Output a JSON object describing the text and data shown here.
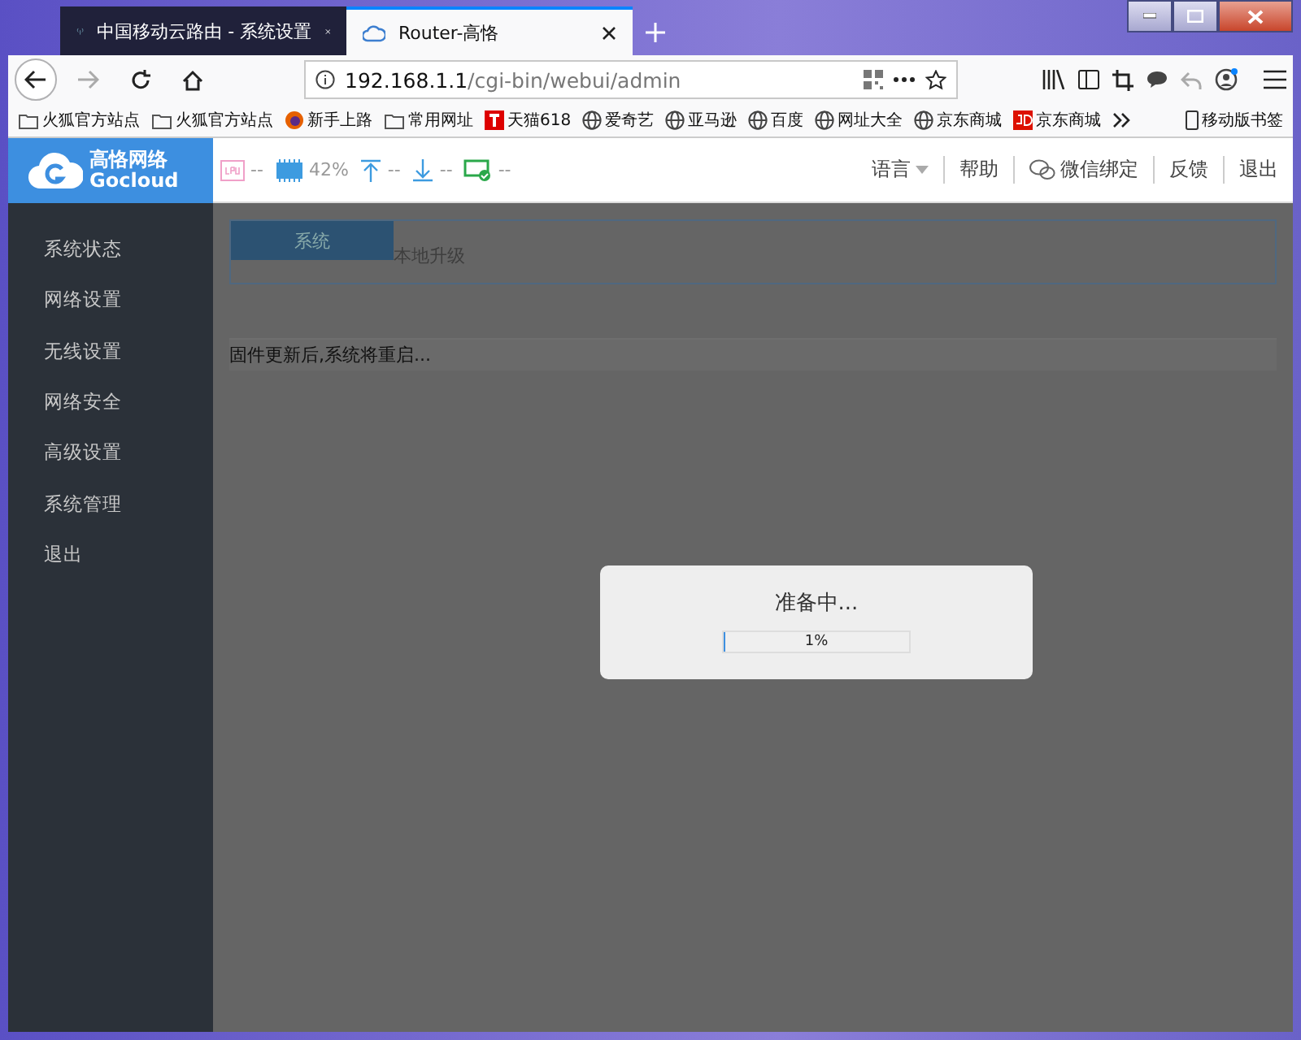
{
  "browser_tabs": [
    {
      "title": "中国移动云路由 - 系统设置",
      "selected": false
    },
    {
      "title": "Router-高恪",
      "selected": true
    }
  ],
  "address_bar": {
    "host": "192.168.1.1",
    "path": "/cgi-bin/webui/admin"
  },
  "bookmarks": [
    {
      "kind": "folder",
      "label": "火狐官方站点"
    },
    {
      "kind": "folder",
      "label": "火狐官方站点"
    },
    {
      "kind": "firefox",
      "label": "新手上路"
    },
    {
      "kind": "folder",
      "label": "常用网址"
    },
    {
      "kind": "tmall",
      "label": "天猫618"
    },
    {
      "kind": "globe",
      "label": "爱奇艺"
    },
    {
      "kind": "globe",
      "label": "亚马逊"
    },
    {
      "kind": "globe",
      "label": "百度"
    },
    {
      "kind": "globe",
      "label": "网址大全"
    },
    {
      "kind": "globe",
      "label": "京东商城"
    },
    {
      "kind": "jd",
      "label": "京东商城"
    }
  ],
  "mobile_bookmarks": "移动版书签",
  "header": {
    "brand": "高恪网络",
    "brand_en": "Gocloud",
    "stats": [
      {
        "kind": "cpu",
        "value": "--"
      },
      {
        "kind": "ram",
        "value": "42%"
      },
      {
        "kind": "up",
        "value": "--"
      },
      {
        "kind": "down",
        "value": "--"
      },
      {
        "kind": "link",
        "value": "--"
      }
    ],
    "links": [
      {
        "kind": "dropdown",
        "label": "语言"
      },
      {
        "kind": "plain",
        "label": "帮助"
      },
      {
        "kind": "wechat",
        "label": "微信绑定"
      },
      {
        "kind": "plain",
        "label": "反馈"
      },
      {
        "kind": "plain",
        "label": "退出"
      }
    ]
  },
  "sidebar": {
    "items": [
      "系统状态",
      "网络设置",
      "无线设置",
      "网络安全",
      "高级设置",
      "系统管理",
      "退出"
    ]
  },
  "content": {
    "tabs": [
      {
        "label": "系统",
        "selected": true
      },
      {
        "label": "本地升级",
        "selected": false
      }
    ],
    "notice": "固件更新后,系统将重启..."
  },
  "dialog": {
    "title": "准备中...",
    "level": 0.01,
    "reading": "1%"
  }
}
